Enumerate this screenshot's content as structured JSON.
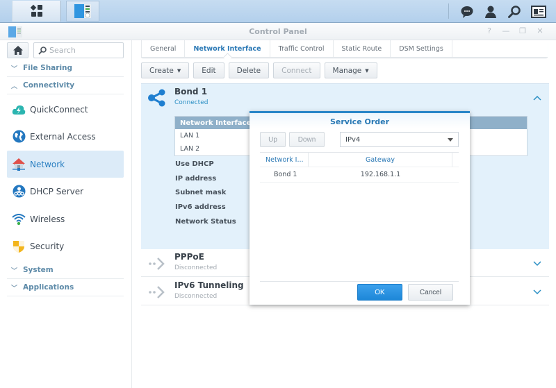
{
  "taskbar": {
    "main_menu_icon": "main-menu-icon",
    "active_app_icon": "control-panel-icon",
    "right_icons": [
      "notifications-icon",
      "user-icon",
      "search-icon",
      "widgets-icon"
    ]
  },
  "window": {
    "title": "Control Panel",
    "controls": {
      "help": "?",
      "minimize": "—",
      "restore": "❐",
      "close": "✕"
    }
  },
  "sidebar": {
    "search_placeholder": "Search",
    "categories": [
      {
        "label": "File Sharing",
        "expanded": false
      },
      {
        "label": "Connectivity",
        "expanded": true
      },
      {
        "label": "System",
        "expanded": false
      },
      {
        "label": "Applications",
        "expanded": false
      }
    ],
    "items": [
      {
        "label": "QuickConnect",
        "icon": "quickconnect-icon",
        "active": false
      },
      {
        "label": "External Access",
        "icon": "globe-icon",
        "active": false
      },
      {
        "label": "Network",
        "icon": "network-house-icon",
        "active": true
      },
      {
        "label": "DHCP Server",
        "icon": "dhcp-server-icon",
        "active": false
      },
      {
        "label": "Wireless",
        "icon": "wifi-icon",
        "active": false
      },
      {
        "label": "Security",
        "icon": "shield-icon",
        "active": false
      }
    ]
  },
  "tabs": [
    {
      "label": "General",
      "active": false
    },
    {
      "label": "Network Interface",
      "active": true
    },
    {
      "label": "Traffic Control",
      "active": false
    },
    {
      "label": "Static Route",
      "active": false
    },
    {
      "label": "DSM Settings",
      "active": false
    }
  ],
  "toolbar": {
    "create": "Create",
    "edit": "Edit",
    "delete": "Delete",
    "connect": "Connect",
    "manage": "Manage"
  },
  "interfaces": {
    "bond": {
      "name": "Bond 1",
      "status": "Connected",
      "table_header": "Network Interface",
      "members": [
        "LAN 1",
        "LAN 2"
      ],
      "properties": [
        "Use DHCP",
        "IP address",
        "Subnet mask",
        "IPv6 address",
        "Network Status"
      ]
    },
    "pppoe": {
      "name": "PPPoE",
      "status": "Disconnected"
    },
    "ipv6": {
      "name": "IPv6 Tunneling",
      "status": "Disconnected"
    }
  },
  "colors": {
    "accent": "#2a86c8",
    "connected": "#2a8fc4",
    "disconnected": "#a4abb2",
    "active_nav_bg": "#dcebf8"
  },
  "modal": {
    "title": "Service Order",
    "up": "Up",
    "down": "Down",
    "protocol": "IPv4",
    "columns": [
      "Network I...",
      "Gateway"
    ],
    "rows": [
      {
        "interface": "Bond 1",
        "gateway": "192.168.1.1"
      }
    ],
    "ok": "OK",
    "cancel": "Cancel"
  }
}
